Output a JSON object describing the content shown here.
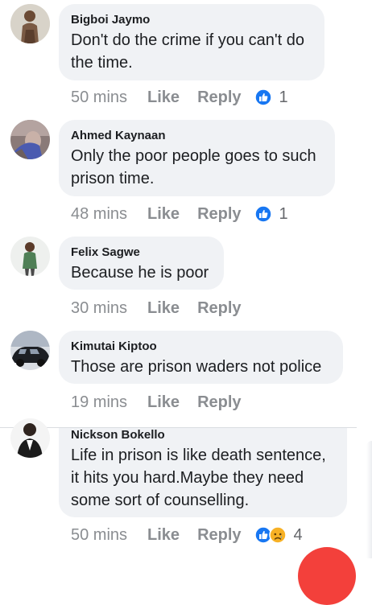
{
  "comments": [
    {
      "author": "Bigboi Jaymo",
      "text_lines": [
        "Don't do the crime if you can't do",
        "the time."
      ],
      "time": "50 mins",
      "like_label": "Like",
      "reply_label": "Reply",
      "reactions": [
        "like-icon"
      ],
      "reaction_count": "1"
    },
    {
      "author": "Ahmed Kaynaan",
      "text_lines": [
        "Only the poor people goes to such",
        "prison time."
      ],
      "time": "48 mins",
      "like_label": "Like",
      "reply_label": "Reply",
      "reactions": [
        "like-icon"
      ],
      "reaction_count": "1"
    },
    {
      "author": "Felix Sagwe",
      "text_lines": [
        "Because he is poor"
      ],
      "time": "30 mins",
      "like_label": "Like",
      "reply_label": "Reply"
    },
    {
      "author": "Kimutai Kiptoo",
      "text_lines": [
        "Those are prison waders not police"
      ],
      "time": "19 mins",
      "like_label": "Like",
      "reply_label": "Reply"
    },
    {
      "author": "Nickson Bokello",
      "text_lines": [
        "Life in prison is like death sentence,",
        "it hits you hard.Maybe they need",
        "some sort of counselling."
      ],
      "time": "50 mins",
      "like_label": "Like",
      "reply_label": "Reply",
      "reactions": [
        "like-icon",
        "sad-icon"
      ],
      "reaction_count": "4"
    }
  ],
  "colors": {
    "bubble": "#f0f2f5",
    "meta_text": "#8a8d91",
    "like_blue": "#1877f2",
    "sad_yellow": "#f7b125",
    "fab_red": "#f3403b"
  }
}
